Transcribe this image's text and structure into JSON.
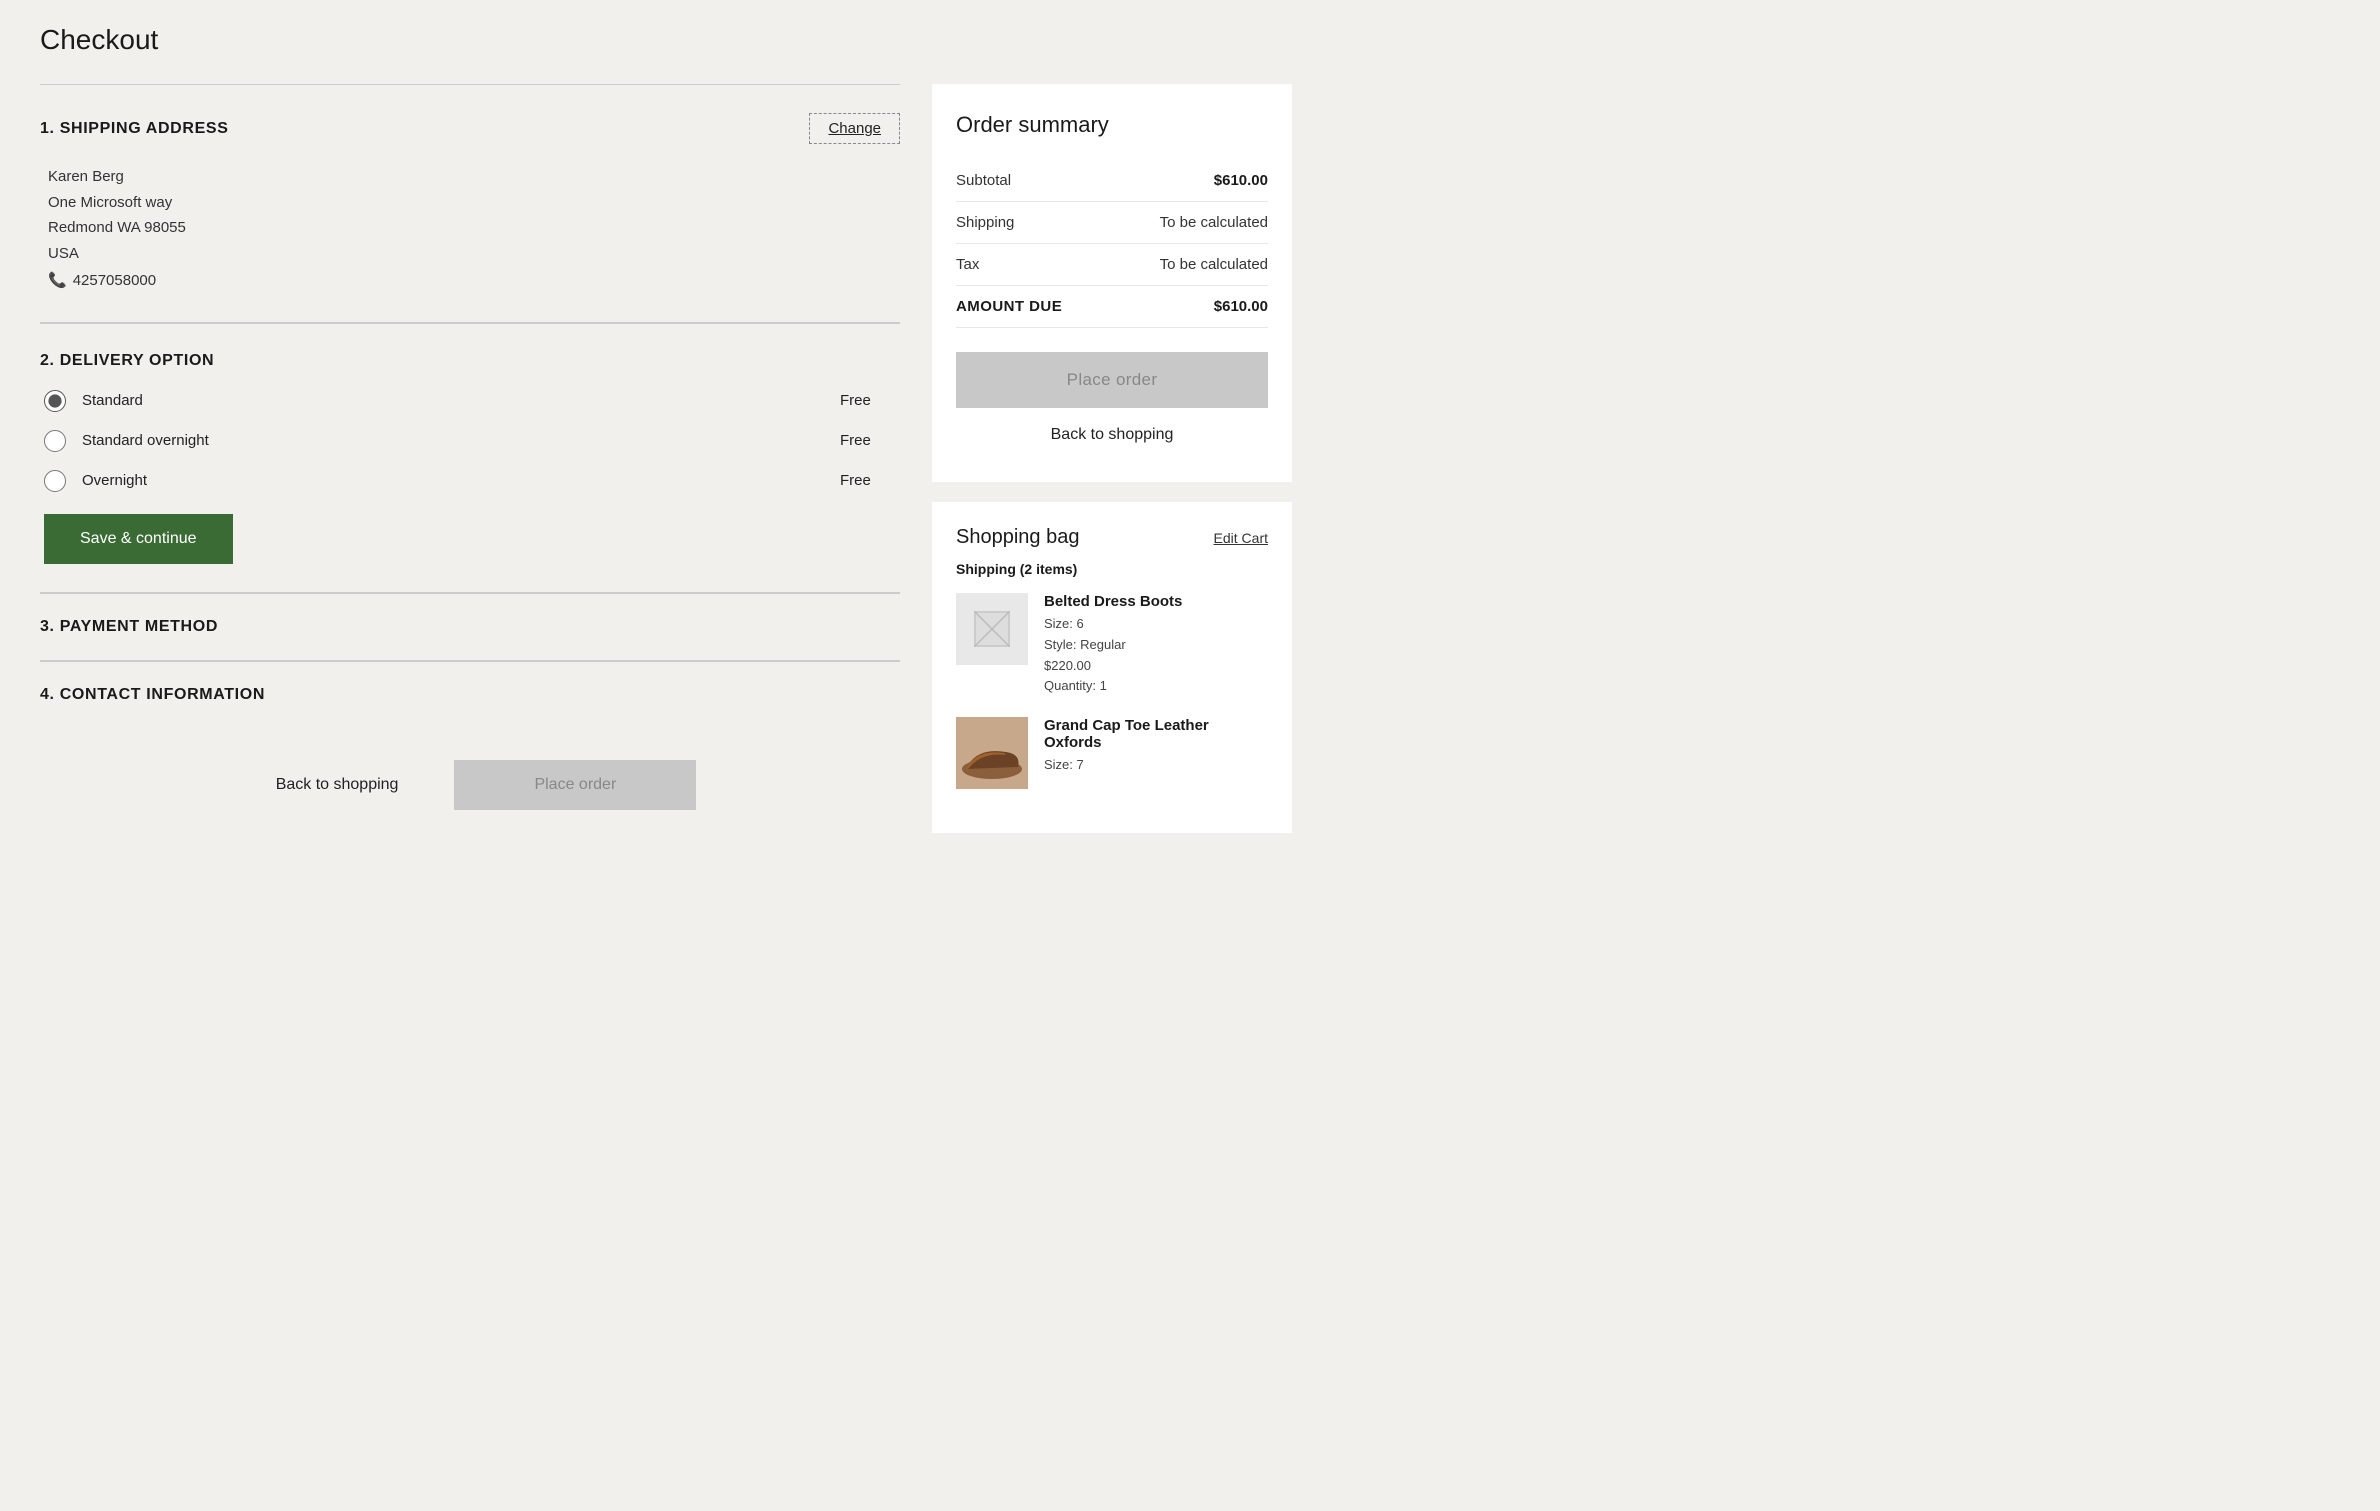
{
  "page": {
    "title": "Checkout"
  },
  "sections": {
    "shipping": {
      "number": "1.",
      "title": "SHIPPING ADDRESS",
      "change_label": "Change",
      "address": {
        "name": "Karen Berg",
        "street": "One Microsoft way",
        "city_state_zip": "Redmond WA  98055",
        "country": "USA",
        "phone": "4257058000",
        "phone_icon": "📞"
      }
    },
    "delivery": {
      "number": "2.",
      "title": "DELIVERY OPTION",
      "options": [
        {
          "id": "standard",
          "label": "Standard",
          "price": "Free",
          "checked": true
        },
        {
          "id": "standard-overnight",
          "label": "Standard overnight",
          "price": "Free",
          "checked": false
        },
        {
          "id": "overnight",
          "label": "Overnight",
          "price": "Free",
          "checked": false
        }
      ],
      "save_label": "Save & continue"
    },
    "payment": {
      "number": "3.",
      "title": "PAYMENT METHOD"
    },
    "contact": {
      "number": "4.",
      "title": "CONTACT INFORMATION"
    }
  },
  "bottom_actions": {
    "back_label": "Back to shopping",
    "place_order_label": "Place order"
  },
  "order_summary": {
    "title": "Order summary",
    "rows": [
      {
        "label": "Subtotal",
        "value": "$610.00",
        "bold_value": true
      },
      {
        "label": "Shipping",
        "value": "To be calculated",
        "bold_value": false
      },
      {
        "label": "Tax",
        "value": "To be calculated",
        "bold_value": false
      },
      {
        "label": "AMOUNT DUE",
        "value": "$610.00",
        "bold_value": true,
        "total": true
      }
    ],
    "place_order_label": "Place order",
    "back_label": "Back to shopping"
  },
  "shopping_bag": {
    "title": "Shopping bag",
    "edit_label": "Edit Cart",
    "shipping_label": "Shipping (2 items)",
    "items": [
      {
        "name": "Belted Dress Boots",
        "size": "Size: 6",
        "style": "Style: Regular",
        "price": "$220.00",
        "quantity": "Quantity: 1",
        "has_image": false
      },
      {
        "name": "Grand Cap Toe Leather Oxfords",
        "size": "Size: 7",
        "style": "",
        "price": "",
        "quantity": "",
        "has_image": true
      }
    ]
  }
}
